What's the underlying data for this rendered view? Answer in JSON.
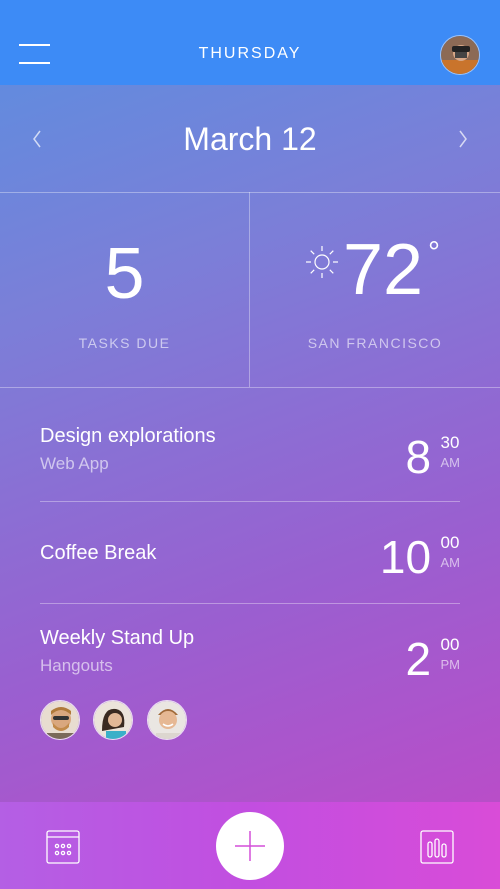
{
  "header": {
    "title": "THURSDAY"
  },
  "date_nav": {
    "date": "March 12"
  },
  "stats": {
    "tasks": {
      "value": "5",
      "label": "TASKS DUE"
    },
    "weather": {
      "temperature": "72",
      "degree": "°",
      "location": "SAN FRANCISCO"
    }
  },
  "events": [
    {
      "title": "Design explorations",
      "subtitle": "Web App",
      "hour": "8",
      "minute": "30",
      "ampm": "AM"
    },
    {
      "title": "Coffee Break",
      "subtitle": "",
      "hour": "10",
      "minute": "00",
      "ampm": "AM"
    },
    {
      "title": "Weekly Stand Up",
      "subtitle": "Hangouts",
      "hour": "2",
      "minute": "00",
      "ampm": "PM"
    }
  ],
  "icons": {
    "menu": "hamburger-menu-icon",
    "prev": "chevron-left-icon",
    "next": "chevron-right-icon",
    "weather": "sun-icon",
    "calendar": "calendar-icon",
    "add": "plus-icon",
    "stats": "bar-chart-icon"
  },
  "colors": {
    "topbar": "#3d8bf6",
    "gradient_start": "#5a8fe0",
    "gradient_end": "#c248c6",
    "add_button": "#ffffff",
    "add_icon": "#d34fd9"
  }
}
